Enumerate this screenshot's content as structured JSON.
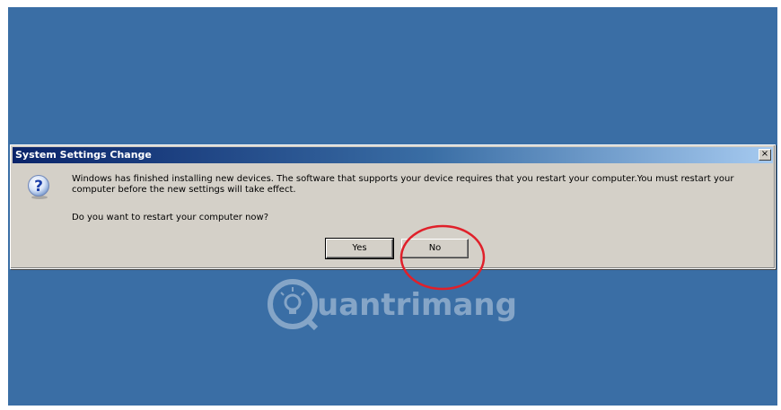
{
  "dialog": {
    "title": "System Settings Change",
    "close_glyph": "×",
    "icon": "question-icon",
    "message": "Windows has finished installing new devices. The software that supports your device requires that you restart your computer.You must restart your computer before the new settings will take effect.",
    "question": "Do you want to restart your computer now?",
    "buttons": {
      "yes_label": "Yes",
      "no_label": "No"
    }
  },
  "watermark": {
    "text": "uantrimang",
    "logo": "quantrimang-logo"
  },
  "colors": {
    "desktop": "#3a6ea5",
    "dialog_face": "#d4d0c8",
    "titlebar_start": "#0a246a",
    "annotation_circle": "#e0202a"
  }
}
